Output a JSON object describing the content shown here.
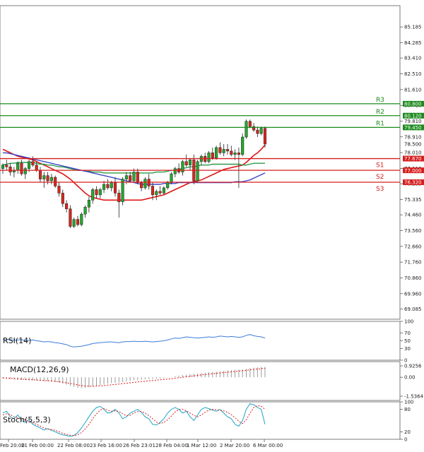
{
  "chart_data": [
    {
      "type": "candlestick",
      "panel": "price",
      "ylim": [
        68.5,
        86.4
      ],
      "y_ticks": [
        "85.185",
        "84.285",
        "83.410",
        "82.510",
        "81.610",
        "80.710",
        "79.810",
        "78.910",
        "78.010",
        "77.110",
        "76.235",
        "75.335",
        "74.460",
        "73.560",
        "72.660",
        "71.760",
        "70.860",
        "69.960",
        "69.085"
      ],
      "x_ticks": [
        "Feb 20:00",
        "21 Feb 00:00",
        "22 Feb 08:00",
        "23 Feb 16:00",
        "26 Feb 23:01",
        "28 Feb 04:00",
        "1 Mar 12:00",
        "2 Mar 20:00",
        "6 Mar 00:00"
      ],
      "last_price": "78.500",
      "levels": [
        {
          "label": "R3",
          "value": 80.8,
          "text": "80.800",
          "color": "#1d8a1d"
        },
        {
          "label": "R2",
          "value": 80.12,
          "text": "80.120",
          "color": "#1d8a1d"
        },
        {
          "label": "R1",
          "value": 79.45,
          "text": "79.450",
          "color": "#1d8a1d"
        },
        {
          "label": "S1",
          "value": 77.67,
          "text": "77.670",
          "color": "#d61e1e"
        },
        {
          "label": "S2",
          "value": 77.0,
          "text": "77.000",
          "color": "#d61e1e"
        },
        {
          "label": "S3",
          "value": 76.32,
          "text": "76.320",
          "color": "#d61e1e"
        }
      ],
      "candles": [
        [
          77.1,
          77.4,
          76.8,
          77.3
        ],
        [
          77.3,
          77.6,
          77.0,
          77.2
        ],
        [
          77.2,
          77.4,
          76.7,
          76.9
        ],
        [
          76.9,
          77.2,
          76.6,
          77.0
        ],
        [
          77.0,
          77.5,
          76.8,
          77.4
        ],
        [
          77.4,
          77.6,
          76.7,
          76.8
        ],
        [
          76.8,
          77.2,
          76.5,
          77.1
        ],
        [
          77.1,
          77.6,
          76.9,
          77.5
        ],
        [
          77.5,
          77.8,
          77.2,
          77.3
        ],
        [
          77.3,
          77.5,
          76.9,
          77.0
        ],
        [
          77.0,
          77.2,
          76.3,
          76.5
        ],
        [
          76.5,
          76.9,
          76.0,
          76.7
        ],
        [
          76.7,
          76.9,
          76.2,
          76.4
        ],
        [
          76.4,
          76.8,
          76.2,
          76.6
        ],
        [
          76.6,
          76.7,
          76.0,
          76.1
        ],
        [
          76.1,
          76.3,
          75.5,
          75.7
        ],
        [
          75.7,
          75.9,
          74.9,
          75.1
        ],
        [
          75.1,
          75.3,
          74.6,
          74.8
        ],
        [
          74.8,
          75.0,
          73.7,
          73.8
        ],
        [
          73.8,
          74.3,
          73.7,
          74.2
        ],
        [
          74.2,
          74.4,
          73.8,
          73.9
        ],
        [
          73.9,
          74.6,
          73.8,
          74.5
        ],
        [
          74.5,
          75.0,
          74.3,
          74.9
        ],
        [
          74.9,
          75.5,
          74.6,
          75.3
        ],
        [
          75.3,
          76.0,
          75.1,
          75.9
        ],
        [
          75.9,
          76.1,
          75.4,
          75.6
        ],
        [
          75.6,
          76.0,
          75.4,
          75.9
        ],
        [
          75.9,
          76.4,
          75.7,
          76.2
        ],
        [
          76.2,
          76.5,
          75.9,
          76.0
        ],
        [
          76.0,
          76.4,
          75.8,
          76.3
        ],
        [
          76.3,
          76.6,
          75.5,
          75.7
        ],
        [
          75.7,
          75.9,
          74.3,
          75.2
        ],
        [
          75.2,
          76.6,
          75.0,
          76.5
        ],
        [
          76.5,
          76.9,
          76.2,
          76.7
        ],
        [
          76.7,
          76.9,
          76.3,
          76.4
        ],
        [
          76.4,
          77.1,
          76.3,
          76.9
        ],
        [
          76.9,
          77.1,
          76.2,
          76.3
        ],
        [
          76.3,
          76.4,
          75.8,
          76.0
        ],
        [
          76.0,
          76.6,
          75.9,
          76.5
        ],
        [
          76.5,
          76.8,
          75.9,
          76.1
        ],
        [
          76.1,
          76.3,
          75.3,
          75.6
        ],
        [
          75.6,
          75.9,
          75.3,
          75.8
        ],
        [
          75.8,
          76.1,
          75.6,
          75.7
        ],
        [
          75.7,
          76.1,
          75.6,
          76.0
        ],
        [
          76.0,
          76.4,
          75.9,
          76.3
        ],
        [
          76.3,
          76.9,
          76.2,
          76.8
        ],
        [
          76.8,
          77.2,
          76.6,
          77.1
        ],
        [
          77.1,
          77.4,
          76.8,
          76.9
        ],
        [
          76.9,
          77.6,
          76.7,
          77.5
        ],
        [
          77.5,
          77.9,
          77.2,
          77.3
        ],
        [
          77.3,
          77.7,
          77.0,
          77.6
        ],
        [
          77.6,
          77.9,
          76.2,
          76.4
        ],
        [
          76.4,
          77.6,
          76.3,
          77.5
        ],
        [
          77.5,
          77.9,
          77.3,
          77.8
        ],
        [
          77.8,
          78.0,
          77.4,
          77.5
        ],
        [
          77.5,
          78.1,
          77.4,
          78.0
        ],
        [
          78.0,
          78.3,
          77.6,
          77.7
        ],
        [
          77.7,
          78.4,
          77.6,
          78.3
        ],
        [
          78.3,
          78.6,
          77.9,
          78.0
        ],
        [
          78.0,
          78.5,
          77.8,
          78.2
        ],
        [
          78.2,
          78.5,
          77.9,
          78.1
        ],
        [
          78.1,
          78.4,
          77.8,
          77.9
        ],
        [
          77.9,
          78.2,
          77.6,
          78.0
        ],
        [
          78.0,
          78.3,
          76.0,
          77.9
        ],
        [
          77.9,
          79.1,
          77.8,
          78.9
        ],
        [
          78.9,
          79.9,
          78.8,
          79.8
        ],
        [
          79.8,
          79.9,
          79.4,
          79.5
        ],
        [
          79.5,
          79.7,
          79.2,
          79.3
        ],
        [
          79.3,
          79.5,
          78.9,
          79.1
        ],
        [
          79.1,
          79.5,
          79.0,
          79.4
        ],
        [
          79.4,
          79.5,
          78.3,
          78.5
        ]
      ],
      "series": [
        {
          "name": "",
          "color": "#e01515",
          "values": [
            78.2,
            78.1,
            78.0,
            77.9,
            77.8,
            77.75,
            77.7,
            77.65,
            77.6,
            77.5,
            77.4,
            77.3,
            77.2,
            77.1,
            77.0,
            76.9,
            76.8,
            76.65,
            76.5,
            76.3,
            76.1,
            75.9,
            75.7,
            75.55,
            75.45,
            75.4,
            75.35,
            75.3,
            75.3,
            75.3,
            75.3,
            75.3,
            75.3,
            75.3,
            75.3,
            75.3,
            75.3,
            75.3,
            75.35,
            75.4,
            75.45,
            75.5,
            75.55,
            75.6,
            75.7,
            75.8,
            75.9,
            76.0,
            76.1,
            76.2,
            76.3,
            76.35,
            76.4,
            76.45,
            76.55,
            76.65,
            76.75,
            76.85,
            76.95,
            77.05,
            77.1,
            77.15,
            77.2,
            77.25,
            77.3,
            77.45,
            77.65,
            77.85,
            78.0,
            78.2,
            78.45
          ]
        },
        {
          "name": "",
          "color": "#2d9a4a",
          "values": [
            77.3,
            77.35,
            77.4,
            77.4,
            77.45,
            77.45,
            77.45,
            77.45,
            77.45,
            77.4,
            77.35,
            77.35,
            77.3,
            77.3,
            77.25,
            77.2,
            77.2,
            77.15,
            77.1,
            77.05,
            77.0,
            77.0,
            76.95,
            76.95,
            76.9,
            76.9,
            76.9,
            76.85,
            76.85,
            76.85,
            76.85,
            76.85,
            76.85,
            76.85,
            76.85,
            76.85,
            76.85,
            76.85,
            76.85,
            76.85,
            76.85,
            76.9,
            76.9,
            76.9,
            76.95,
            77.0,
            77.0,
            77.05,
            77.1,
            77.15,
            77.2,
            77.2,
            77.25,
            77.3,
            77.3,
            77.3,
            77.35,
            77.35,
            77.35,
            77.35,
            77.35,
            77.35,
            77.35,
            77.35,
            77.3,
            77.3,
            77.35,
            77.4,
            77.4,
            77.4,
            77.4
          ]
        },
        {
          "name": "",
          "color": "#3b46c9",
          "values": [
            78.0,
            78.0,
            77.95,
            77.9,
            77.85,
            77.8,
            77.75,
            77.7,
            77.65,
            77.6,
            77.55,
            77.5,
            77.45,
            77.4,
            77.35,
            77.3,
            77.25,
            77.2,
            77.15,
            77.1,
            77.05,
            77.0,
            76.95,
            76.9,
            76.85,
            76.8,
            76.75,
            76.7,
            76.65,
            76.6,
            76.55,
            76.5,
            76.45,
            76.4,
            76.35,
            76.3,
            76.25,
            76.2,
            76.2,
            76.2,
            76.2,
            76.2,
            76.2,
            76.25,
            76.25,
            76.25,
            76.25,
            76.3,
            76.3,
            76.3,
            76.3,
            76.3,
            76.3,
            76.3,
            76.3,
            76.3,
            76.3,
            76.3,
            76.3,
            76.3,
            76.3,
            76.3,
            76.35,
            76.35,
            76.35,
            76.4,
            76.45,
            76.55,
            76.65,
            76.75,
            76.85
          ]
        }
      ]
    },
    {
      "type": "line",
      "panel": "rsi",
      "title": "RSI(14)",
      "ylim": [
        0,
        100
      ],
      "y_ticks": [
        "100",
        "70",
        "50",
        "30",
        "0"
      ],
      "series": [
        {
          "name": "RSI(14)",
          "color": "#3b7dd8",
          "values": [
            54,
            53,
            53,
            51,
            52,
            53,
            50,
            51,
            52,
            50,
            49,
            47,
            48,
            47,
            45,
            44,
            42,
            40,
            36,
            34,
            35,
            36,
            38,
            40,
            43,
            44,
            45,
            46,
            47,
            47,
            46,
            45,
            47,
            48,
            48,
            49,
            48,
            48,
            49,
            48,
            47,
            48,
            49,
            50,
            52,
            55,
            57,
            56,
            58,
            60,
            59,
            58,
            57,
            58,
            59,
            60,
            59,
            60,
            62,
            61,
            60,
            61,
            60,
            59,
            60,
            64,
            66,
            63,
            61,
            60,
            57
          ]
        }
      ]
    },
    {
      "type": "bar",
      "panel": "macd",
      "title": "MACD(12,26,9)",
      "y_ticks": [
        "0.9256",
        "0.00",
        "-1.5364"
      ],
      "series": [
        {
          "name": "MACD(12,26,9)",
          "color": "#9a9a9a",
          "values": [
            -0.1,
            -0.12,
            -0.15,
            -0.18,
            -0.2,
            -0.22,
            -0.24,
            -0.25,
            -0.26,
            -0.28,
            -0.3,
            -0.32,
            -0.34,
            -0.37,
            -0.4,
            -0.45,
            -0.52,
            -0.6,
            -0.7,
            -0.78,
            -0.85,
            -0.88,
            -0.86,
            -0.82,
            -0.76,
            -0.7,
            -0.64,
            -0.58,
            -0.52,
            -0.48,
            -0.45,
            -0.42,
            -0.38,
            -0.33,
            -0.28,
            -0.24,
            -0.22,
            -0.2,
            -0.17,
            -0.15,
            -0.14,
            -0.12,
            -0.1,
            -0.07,
            -0.03,
            0.02,
            0.08,
            0.13,
            0.18,
            0.22,
            0.26,
            0.28,
            0.3,
            0.34,
            0.37,
            0.4,
            0.43,
            0.46,
            0.49,
            0.52,
            0.55,
            0.58,
            0.6,
            0.62,
            0.64,
            0.68,
            0.74,
            0.78,
            0.81,
            0.83,
            0.84
          ]
        },
        {
          "name": "",
          "color": "#e01515",
          "values": [
            -0.05,
            -0.07,
            -0.09,
            -0.11,
            -0.13,
            -0.15,
            -0.17,
            -0.19,
            -0.2,
            -0.22,
            -0.24,
            -0.26,
            -0.28,
            -0.3,
            -0.33,
            -0.36,
            -0.4,
            -0.45,
            -0.5,
            -0.56,
            -0.62,
            -0.67,
            -0.71,
            -0.73,
            -0.73,
            -0.72,
            -0.7,
            -0.67,
            -0.64,
            -0.61,
            -0.58,
            -0.55,
            -0.52,
            -0.49,
            -0.45,
            -0.42,
            -0.38,
            -0.35,
            -0.32,
            -0.29,
            -0.26,
            -0.23,
            -0.21,
            -0.18,
            -0.15,
            -0.12,
            -0.08,
            -0.04,
            0.0,
            0.04,
            0.08,
            0.12,
            0.15,
            0.19,
            0.22,
            0.26,
            0.29,
            0.32,
            0.35,
            0.38,
            0.41,
            0.44,
            0.47,
            0.5,
            0.53,
            0.56,
            0.6,
            0.64,
            0.67,
            0.7,
            0.73
          ]
        }
      ]
    },
    {
      "type": "line",
      "panel": "stoch",
      "title": "Stoch(5,5,3)",
      "ylim": [
        0,
        100
      ],
      "y_ticks": [
        "100",
        "80",
        "20",
        "0"
      ],
      "series": [
        {
          "name": "Stoch(5,5,3)",
          "color": "#1fa4c4",
          "values": [
            70,
            75,
            60,
            55,
            65,
            50,
            45,
            52,
            40,
            35,
            30,
            25,
            28,
            24,
            20,
            15,
            12,
            10,
            8,
            10,
            18,
            30,
            45,
            60,
            75,
            85,
            88,
            80,
            70,
            72,
            80,
            70,
            55,
            60,
            70,
            75,
            80,
            72,
            60,
            55,
            40,
            38,
            45,
            55,
            70,
            80,
            85,
            80,
            70,
            75,
            60,
            50,
            65,
            80,
            85,
            82,
            78,
            75,
            80,
            70,
            60,
            55,
            40,
            35,
            50,
            80,
            95,
            92,
            85,
            80,
            40
          ]
        },
        {
          "name": "",
          "color": "#d61e1e",
          "values": [
            65,
            68,
            66,
            60,
            58,
            55,
            52,
            48,
            44,
            40,
            35,
            30,
            28,
            26,
            24,
            20,
            16,
            13,
            11,
            10,
            12,
            18,
            28,
            40,
            55,
            68,
            78,
            82,
            78,
            75,
            76,
            75,
            68,
            63,
            64,
            70,
            74,
            74,
            70,
            63,
            55,
            46,
            42,
            45,
            52,
            62,
            73,
            80,
            80,
            76,
            70,
            64,
            60,
            65,
            72,
            78,
            80,
            79,
            77,
            76,
            72,
            66,
            58,
            48,
            42,
            52,
            70,
            85,
            90,
            88,
            80
          ]
        }
      ]
    }
  ]
}
